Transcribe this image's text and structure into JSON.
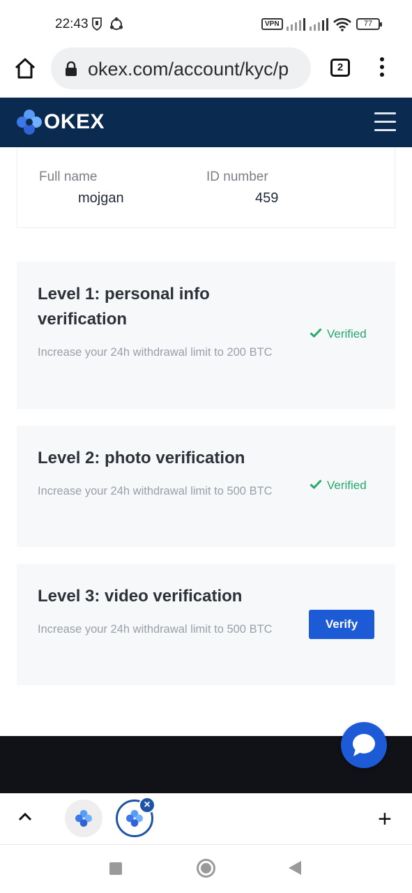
{
  "status_bar": {
    "time": "22:43",
    "vpn_label": "VPN",
    "battery_level": "77"
  },
  "browser": {
    "url": "okex.com/account/kyc/p",
    "tab_count": "2"
  },
  "header": {
    "brand_name": "OKEX",
    "brand_color": "#0b2a4f"
  },
  "identity": {
    "full_name_label": "Full name",
    "full_name_value": "mojgan",
    "id_number_label": "ID number",
    "id_number_value": "459"
  },
  "levels": [
    {
      "title": "Level 1: personal info verification",
      "description": "Increase your 24h withdrawal limit to 200 BTC",
      "status": "Verified"
    },
    {
      "title": "Level 2: photo verification",
      "description": "Increase your 24h withdrawal limit to 500 BTC",
      "status": "Verified"
    },
    {
      "title": "Level 3: video verification",
      "description": "Increase your 24h withdrawal limit to 500 BTC",
      "action_label": "Verify"
    }
  ],
  "colors": {
    "accent_blue": "#1c5ad6",
    "verified_green": "#26a96c"
  }
}
